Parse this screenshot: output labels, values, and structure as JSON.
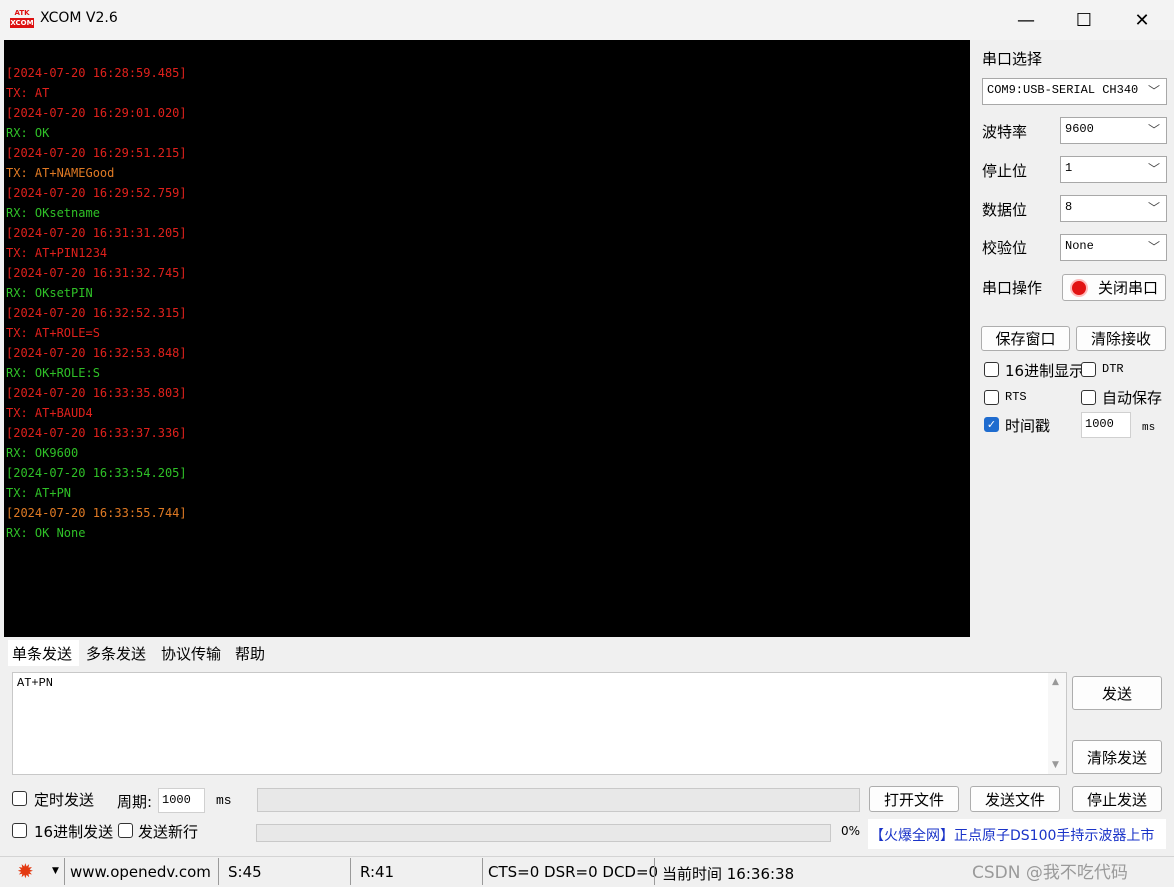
{
  "window": {
    "logo_line1": "ATK",
    "logo_line2": "XCOM",
    "title": "XCOM V2.6",
    "minimize": "—",
    "maximize": "☐",
    "close": "✕"
  },
  "terminal": {
    "lines": [
      {
        "text": "[2024-07-20 16:28:59.485]",
        "color": "red"
      },
      {
        "text": "TX: AT",
        "color": "red"
      },
      {
        "text": "[2024-07-20 16:29:01.020]",
        "color": "red"
      },
      {
        "text": "RX: OK",
        "color": "green"
      },
      {
        "text": "[2024-07-20 16:29:51.215]",
        "color": "red"
      },
      {
        "text": "TX: AT+NAMEGood",
        "color": "olive"
      },
      {
        "text": "[2024-07-20 16:29:52.759]",
        "color": "red"
      },
      {
        "text": "RX: OKsetname",
        "color": "green"
      },
      {
        "text": "[2024-07-20 16:31:31.205]",
        "color": "red"
      },
      {
        "text": "TX: AT+PIN1234",
        "color": "red"
      },
      {
        "text": "[2024-07-20 16:31:32.745]",
        "color": "red"
      },
      {
        "text": "RX: OKsetPIN",
        "color": "green"
      },
      {
        "text": "[2024-07-20 16:32:52.315]",
        "color": "red"
      },
      {
        "text": "TX: AT+ROLE=S",
        "color": "red"
      },
      {
        "text": "[2024-07-20 16:32:53.848]",
        "color": "red"
      },
      {
        "text": "RX: OK+ROLE:S",
        "color": "green"
      },
      {
        "text": "[2024-07-20 16:33:35.803]",
        "color": "red"
      },
      {
        "text": "TX: AT+BAUD4",
        "color": "red"
      },
      {
        "text": "[2024-07-20 16:33:37.336]",
        "color": "red"
      },
      {
        "text": "RX: OK9600",
        "color": "green"
      },
      {
        "text": "[2024-07-20 16:33:54.205]",
        "color": "green"
      },
      {
        "text": "TX: AT+PN",
        "color": "green"
      },
      {
        "text": "[2024-07-20 16:33:55.744]",
        "color": "olive"
      },
      {
        "text": "RX: OK None",
        "color": "green"
      }
    ]
  },
  "colors": {
    "red": "#e0211c",
    "green": "#2fc027",
    "olive": "#e07a24",
    "checkbox_on": "#1f6ccf",
    "ad_text": "#1a33c8"
  },
  "settings": {
    "port_label": "串口选择",
    "port_value": "COM9:USB-SERIAL CH340",
    "baud_label": "波特率",
    "baud_value": "9600",
    "stop_label": "停止位",
    "stop_value": "1",
    "data_label": "数据位",
    "data_value": "8",
    "parity_label": "校验位",
    "parity_value": "None",
    "op_label": "串口操作",
    "close_port": "关闭串口",
    "save_window": "保存窗口",
    "clear_receive": "清除接收",
    "hex_display": "16进制显示",
    "dtr": "DTR",
    "rts": "RTS",
    "auto_save": "自动保存",
    "timestamp": "时间戳",
    "timestamp_value": "1000",
    "timestamp_unit": "ms",
    "timestamp_checked": true
  },
  "tabs": [
    "单条发送",
    "多条发送",
    "协议传输",
    "帮助"
  ],
  "send": {
    "text": "AT+PN",
    "send_button": "发送",
    "clear_send_button": "清除发送",
    "timed_send": "定时发送",
    "period_label": "周期:",
    "period_value": "1000",
    "period_unit": "ms",
    "open_file": "打开文件",
    "send_file": "发送文件",
    "stop_send": "停止发送",
    "hex_send": "16进制发送",
    "send_newline": "发送新行",
    "progress_text": "0%",
    "progress": 0,
    "ad_text": "【火爆全网】正点原子DS100手持示波器上市"
  },
  "status": {
    "url": "www.openedv.com",
    "sent": "S:45",
    "received": "R:41",
    "signals": "CTS=0 DSR=0 DCD=0",
    "time": "当前时间 16:36:38",
    "watermark": "CSDN @我不吃代码"
  }
}
